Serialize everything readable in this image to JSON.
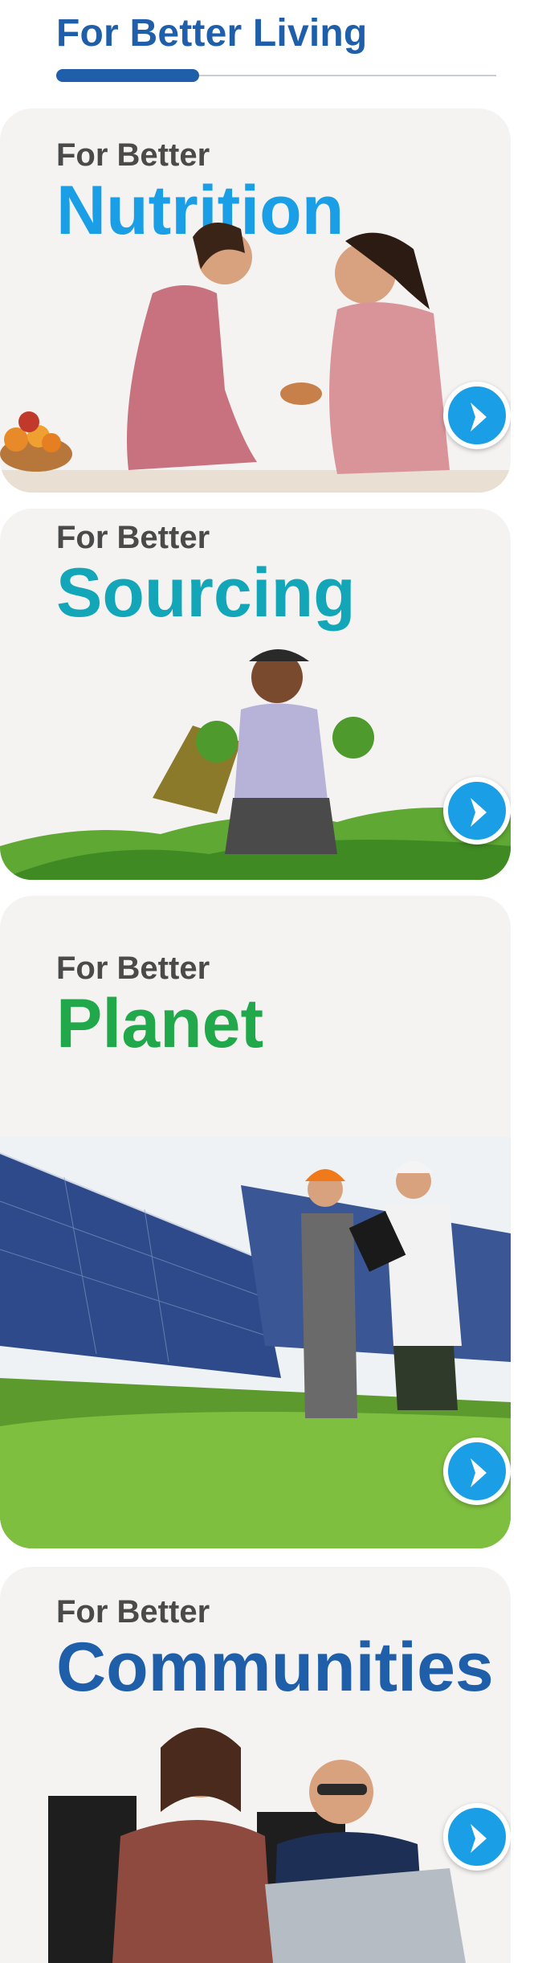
{
  "header": {
    "title": "For Better Living"
  },
  "cards": [
    {
      "eyebrow": "For Better",
      "headline": "Nutrition",
      "color": "#1a9ee6"
    },
    {
      "eyebrow": "For Better",
      "headline": "Sourcing",
      "color": "#13a6b8"
    },
    {
      "eyebrow": "For Better",
      "headline": "Planet",
      "color": "#21a84a"
    },
    {
      "eyebrow": "For Better",
      "headline": "Communities",
      "color": "#1f5fa9"
    }
  ],
  "icons": {
    "arrow": "chevron-right-icon"
  },
  "colors": {
    "brand": "#1f5fa9",
    "button": "#1a9ee6",
    "card_bg": "#f4f3f1"
  }
}
